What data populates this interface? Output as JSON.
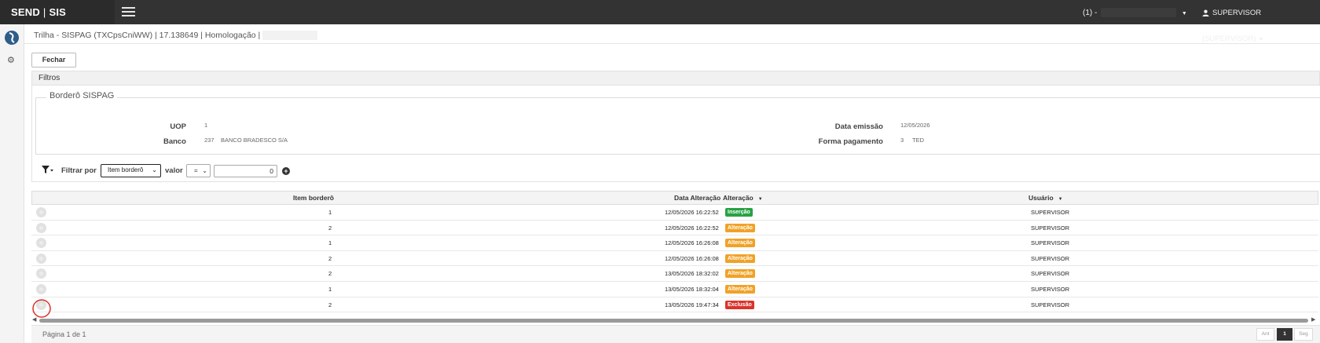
{
  "app": {
    "brand_left": "SEND",
    "brand_sep": "|",
    "brand_right": "SIS"
  },
  "topbar": {
    "env_label": "(1) -",
    "user_label": "SUPERVISOR (SUPERVISOR)"
  },
  "page": {
    "title": "Trilha - SISPAG (TXCpsCniWW) | 17.138649 | Homologação |"
  },
  "toolbar": {
    "close_label": "Fechar"
  },
  "filters": {
    "header": "Filtros",
    "legend": "Borderô SISPAG",
    "uop_label": "UOP",
    "uop_value": "1",
    "banco_label": "Banco",
    "banco_code": "237",
    "banco_name": "BANCO BRADESCO S/A",
    "data_emissao_label": "Data emissão",
    "data_emissao_value": "12/05/2026",
    "forma_pagamento_label": "Forma pagamento",
    "forma_pagamento_code": "3",
    "forma_pagamento_name": "TED"
  },
  "filterbar": {
    "filtrar_label": "Filtrar por",
    "field_selected": "Item borderô",
    "valor_label": "valor",
    "operator_selected": "=",
    "value": "0",
    "add_icon": "plus-circle-icon"
  },
  "grid": {
    "columns": {
      "item": "Item borderô",
      "data": "Data Alteração",
      "alteracao": "Alteração",
      "usuario": "Usuário"
    },
    "rows": [
      {
        "item": "1",
        "data": "12/05/2026 16:22:52",
        "alteracao": "Inserção",
        "color": "#27a243",
        "usuario": "SUPERVISOR"
      },
      {
        "item": "2",
        "data": "12/05/2026 16:22:52",
        "alteracao": "Alteração",
        "color": "#f0a227",
        "usuario": "SUPERVISOR"
      },
      {
        "item": "1",
        "data": "12/05/2026 16:26:08",
        "alteracao": "Alteração",
        "color": "#f0a227",
        "usuario": "SUPERVISOR"
      },
      {
        "item": "2",
        "data": "12/05/2026 16:26:08",
        "alteracao": "Alteração",
        "color": "#f0a227",
        "usuario": "SUPERVISOR"
      },
      {
        "item": "2",
        "data": "13/05/2026 18:32:02",
        "alteracao": "Alteração",
        "color": "#f0a227",
        "usuario": "SUPERVISOR"
      },
      {
        "item": "1",
        "data": "13/05/2026 18:32:04",
        "alteracao": "Alteração",
        "color": "#f0a227",
        "usuario": "SUPERVISOR"
      },
      {
        "item": "2",
        "data": "13/05/2026 19:47:34",
        "alteracao": "Exclusão",
        "color": "#d9342b",
        "usuario": "SUPERVISOR"
      }
    ]
  },
  "pagination": {
    "info": "Página 1 de 1",
    "prev": "Ant",
    "current": "1",
    "next": "Seg"
  },
  "colors": {
    "topbar": "#333333",
    "brand_bg": "#2b2b2b",
    "insert": "#27a243",
    "update": "#f0a227",
    "delete": "#d9342b",
    "highlight": "#d9342b"
  }
}
